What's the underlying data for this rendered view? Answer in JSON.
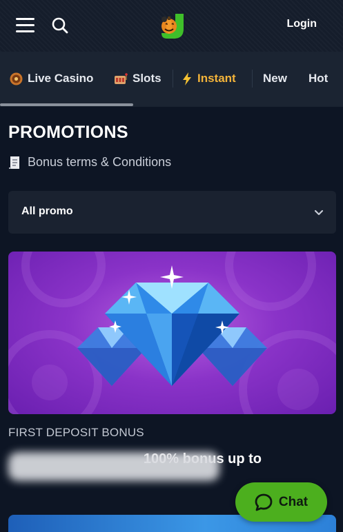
{
  "header": {
    "login_label": "Login"
  },
  "tabs": [
    {
      "label": "Live Casino",
      "icon": "roulette-icon"
    },
    {
      "label": "Slots",
      "icon": "slot-machine-icon"
    },
    {
      "label": "Instant",
      "icon": "lightning-icon",
      "active": true
    },
    {
      "label": "New"
    },
    {
      "label": "Hot"
    }
  ],
  "page": {
    "title": "PROMOTIONS",
    "terms_label": "Bonus terms & Conditions"
  },
  "filter": {
    "selected": "All promo"
  },
  "promo": {
    "category": "FIRST DEPOSIT BONUS",
    "headline": "100% bonus up to"
  },
  "chat": {
    "label": "Chat"
  },
  "colors": {
    "accent_tab": "#f4b43a",
    "chat_green": "#4caf1e",
    "background": "#0d1524"
  }
}
